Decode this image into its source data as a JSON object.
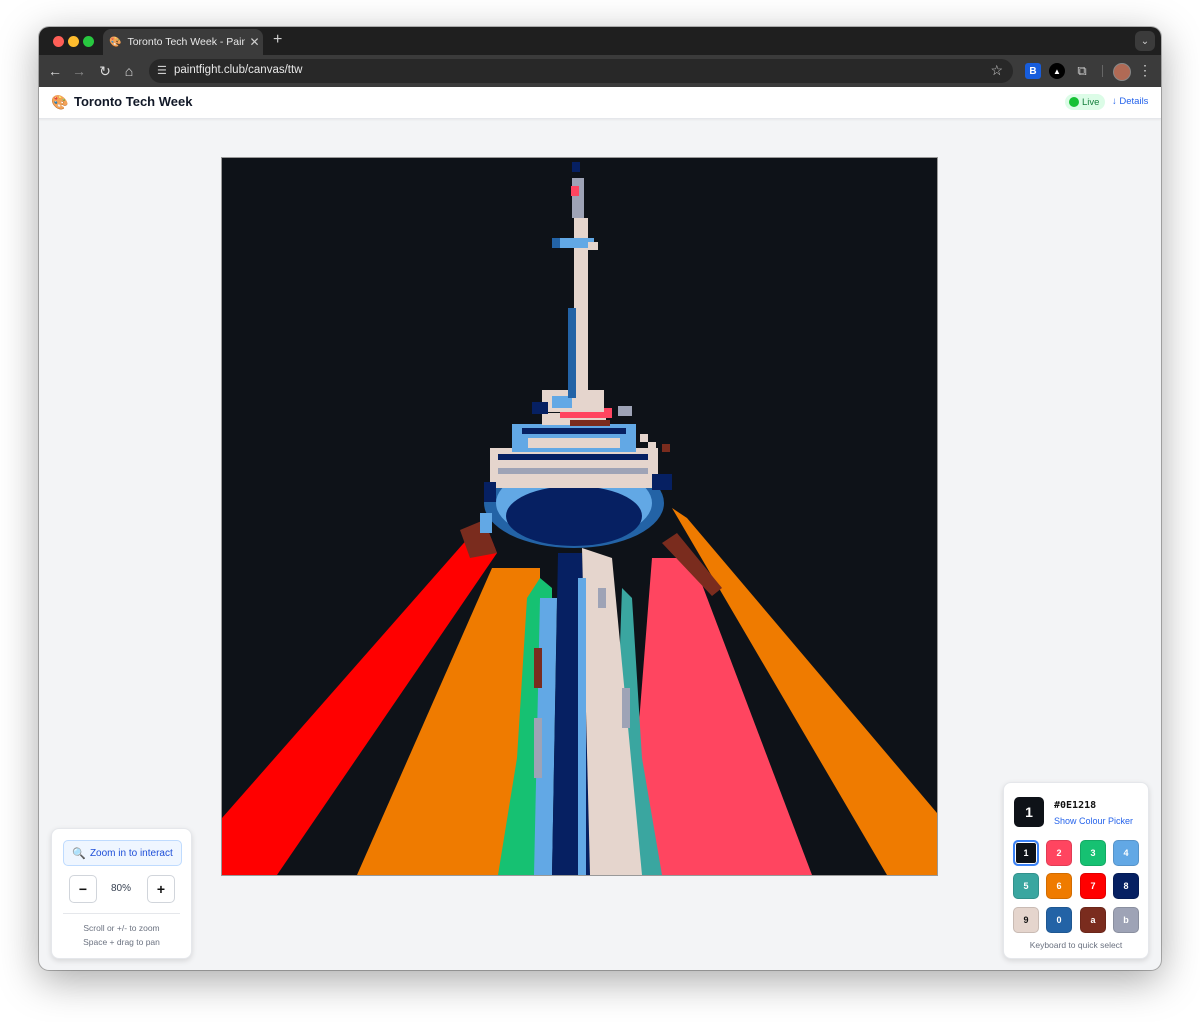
{
  "browser": {
    "tab_title": "Toronto Tech Week - Paint Fight",
    "tab_favicon": "🎨",
    "url": "paintfight.club/canvas/ttw",
    "icons": {
      "back": "←",
      "forward": "→",
      "reload": "↻",
      "home": "⌂",
      "tune": "☰",
      "star": "☆",
      "puzzle": "⧉",
      "kebab": "⋮",
      "new_tab": "+",
      "close": "✕",
      "dropdown": "⌄",
      "bitwarden": "B",
      "triangle": "▲"
    }
  },
  "header": {
    "logo": "🎨",
    "title": "Toronto Tech Week",
    "live_label": "Live",
    "details_label": "↓ Details"
  },
  "zoom": {
    "interact_icon": "🔍",
    "interact_label": "Zoom in to interact",
    "minus_label": "−",
    "plus_label": "+",
    "percent": "80%",
    "hint_scroll": "Scroll or +/- to zoom",
    "hint_pan": "Space + drag to pan"
  },
  "palette": {
    "selected_key": "1",
    "selected_hex": "#0E1218",
    "show_picker_label": "Show Colour Picker",
    "keyboard_hint": "Keyboard to quick select",
    "swatches": [
      {
        "key": "1",
        "color": "#0e1218",
        "text_color": "#ffffff"
      },
      {
        "key": "2",
        "color": "#ff4560",
        "text_color": "#ffffff"
      },
      {
        "key": "3",
        "color": "#16c172",
        "text_color": "#ffffff"
      },
      {
        "key": "4",
        "color": "#62a8e5",
        "text_color": "#ffffff"
      },
      {
        "key": "5",
        "color": "#3aa6a0",
        "text_color": "#ffffff"
      },
      {
        "key": "6",
        "color": "#ef7b00",
        "text_color": "#ffffff"
      },
      {
        "key": "7",
        "color": "#ff0000",
        "text_color": "#ffffff"
      },
      {
        "key": "8",
        "color": "#062062",
        "text_color": "#ffffff"
      },
      {
        "key": "9",
        "color": "#e5d5cd",
        "text_color": "#111111"
      },
      {
        "key": "0",
        "color": "#2363a6",
        "text_color": "#ffffff"
      },
      {
        "key": "a",
        "color": "#7a2c1e",
        "text_color": "#ffffff"
      },
      {
        "key": "b",
        "color": "#9ea3b6",
        "text_color": "#ffffff"
      }
    ]
  },
  "canvas_colors": {
    "sky": "#0e1218",
    "red": "#ff0000",
    "orange": "#ef7b00",
    "pink": "#ff4560",
    "green": "#16c172",
    "teal": "#3aa6a0",
    "light_blue": "#62a8e5",
    "navy": "#062062",
    "blue": "#2363a6",
    "cream": "#e5d5cd",
    "brown": "#7a2c1e",
    "gray": "#9ea3b6"
  }
}
